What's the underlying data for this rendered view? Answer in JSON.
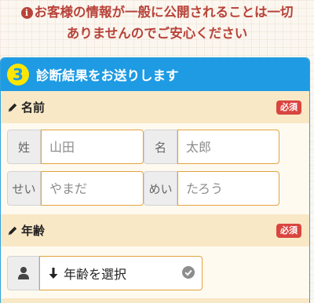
{
  "notice": {
    "icon": "info-circle-icon",
    "line1": "お客様の情報が一般に公開されることは一切",
    "line2": "ありませんのでご安心ください"
  },
  "step": {
    "number": "3",
    "title": "診断結果をお送りします"
  },
  "name_section": {
    "icon": "pencil-icon",
    "label": "名前",
    "required_badge": "必須",
    "fields": {
      "surname_label": "姓",
      "surname_value": "山田",
      "given_label": "名",
      "given_value": "太郎",
      "surname_kana_label": "せい",
      "surname_kana_value": "やまだ",
      "given_kana_label": "めい",
      "given_kana_value": "たろう"
    }
  },
  "age_section": {
    "icon": "pencil-icon",
    "label": "年齢",
    "required_badge": "必須",
    "select_icon": "user-icon",
    "select_label": "年齢を選択",
    "select_state_icon": "check-circle-icon"
  },
  "colors": {
    "header_blue": "#1e9be3",
    "notice_red": "#b8433a",
    "required_red": "#d9453f",
    "field_border": "#e3a23f",
    "step_yellow": "#ffe600"
  }
}
